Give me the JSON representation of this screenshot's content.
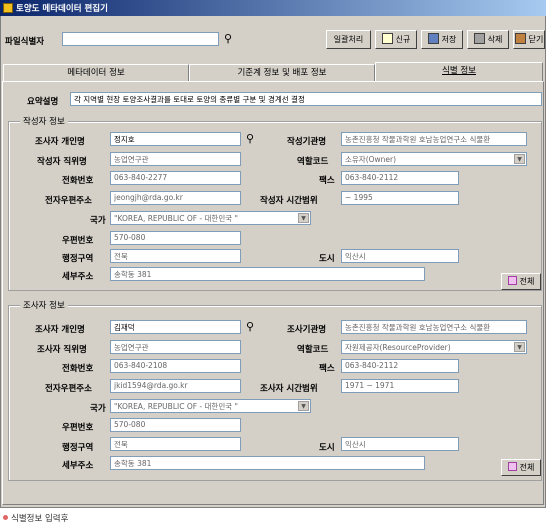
{
  "window": {
    "title": "토양도 메타데이터 편집기"
  },
  "toolbar": {
    "file_id_label": "파일식별자",
    "file_id_value": "",
    "batch_label": "일괄처리",
    "new_label": "신규",
    "save_label": "저장",
    "delete_label": "삭제",
    "close_label": "닫기"
  },
  "tabs": [
    {
      "label": "메타데이터 정보"
    },
    {
      "label": "기준계 정보 및 배포 정보"
    },
    {
      "label": "식별 정보"
    }
  ],
  "summary": {
    "label": "요약설명",
    "value": "각 지역별 현장 토양조사결과를 토대로 토양의 종류별 구분 및 경계선 결정"
  },
  "author": {
    "section_title": "작성자 정보",
    "name_label": "조사자 개인명",
    "name_value": "정지호",
    "org_label": "작성기관명",
    "org_value": "농촌진흥청 작물과학원 호남농업연구소 식물환",
    "position_label": "작성자 직위명",
    "position_value": "농업연구관",
    "role_label": "역할코드",
    "role_value": "소유자(Owner)",
    "phone_label": "전화번호",
    "phone_value": "063-840-2277",
    "fax_label": "팩스",
    "fax_value": "063-840-2112",
    "email_label": "전자우편주소",
    "email_value": "jeongjh@rda.go.kr",
    "period_label": "작성자 시간범위",
    "period_value": "~ 1995",
    "country_label": "국가",
    "country_value": "\"KOREA, REPUBLIC OF - 대한민국 \"",
    "zip_label": "우편번호",
    "zip_value": "570-080",
    "district_label": "행정구역",
    "district_value": "전북",
    "city_label": "도시",
    "city_value": "익산시",
    "address_label": "세부주소",
    "address_value": "송학동 381",
    "all_label": "전체"
  },
  "surveyor": {
    "section_title": "조사자 정보",
    "name_label": "조사자 개인명",
    "name_value": "김재덕",
    "org_label": "조사기관명",
    "org_value": "농촌진흥청 작물과학원 호남농업연구소 식물환",
    "position_label": "조사자 직위명",
    "position_value": "농업연구관",
    "role_label": "역할코드",
    "role_value": "자원제공자(ResourceProvider)",
    "phone_label": "전화번호",
    "phone_value": "063-840-2108",
    "fax_label": "팩스",
    "fax_value": "063-840-2112",
    "email_label": "전자우편주소",
    "email_value": "jkid1594@rda.go.kr",
    "period_label": "조사자 시간범위",
    "period_value": "1971 ~ 1971",
    "country_label": "국가",
    "country_value": "\"KOREA, REPUBLIC OF - 대한민국 \"",
    "zip_label": "우편번호",
    "zip_value": "570-080",
    "district_label": "행정구역",
    "district_value": "전북",
    "city_label": "도시",
    "city_value": "익산시",
    "address_label": "세부주소",
    "address_value": "송학동 381",
    "all_label": "전체"
  },
  "caption": "식별정보 입력후",
  "icons": {
    "search": "binoculars-icon",
    "new": "new-doc-icon",
    "save": "floppy-icon",
    "delete": "trash-icon",
    "close": "exit-icon"
  }
}
